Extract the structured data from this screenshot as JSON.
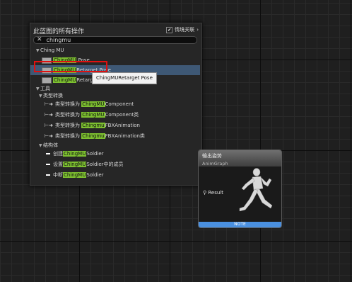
{
  "menu": {
    "title": "此蓝图的所有操作",
    "context_label": "情境关联",
    "context_checked": "✔",
    "context_arrow": "›",
    "search_value": "chingmu",
    "search_clear": "✕"
  },
  "tree": {
    "category1": "Ching MU",
    "items": [
      {
        "hl": "ChingMU",
        "rest": " Pose"
      },
      {
        "hl": "ChingMU",
        "rest": "Retarget Pose"
      },
      {
        "hl": "ChingMU",
        "rest": "Retarget"
      }
    ],
    "category2": "工具",
    "sub_convert": "类型转换",
    "convert_items": [
      {
        "pre": "类型转换为 ",
        "hl": "ChingMU",
        "rest": "Component"
      },
      {
        "pre": "类型转换为 ",
        "hl": "ChingMU",
        "rest": "Component类"
      },
      {
        "pre": "类型转换为 ",
        "hl": "Chingmu",
        "rest": "FBXAnimation"
      },
      {
        "pre": "类型转换为 ",
        "hl": "Chingmu",
        "rest": "FBXAnimation类"
      }
    ],
    "sub_struct": "结构体",
    "struct_items": [
      {
        "pre": "创建",
        "hl": "ChingMU",
        "rest": "Soldier"
      },
      {
        "pre": "设置",
        "hl": "ChingMU",
        "rest": "Soldier中的成员"
      },
      {
        "pre": "中断",
        "hl": "ChingMU",
        "rest": "Soldier"
      }
    ]
  },
  "tooltip": "ChingMURetarget Pose",
  "node": {
    "title": "输出姿势",
    "subtitle": "AnimGraph",
    "pin_label": "Result",
    "footer": "NOTE"
  },
  "colors": {
    "highlight": "#7dc030",
    "selection": "#3e5875",
    "red_box": "#e01010",
    "note_bar": "#4a90e0"
  }
}
